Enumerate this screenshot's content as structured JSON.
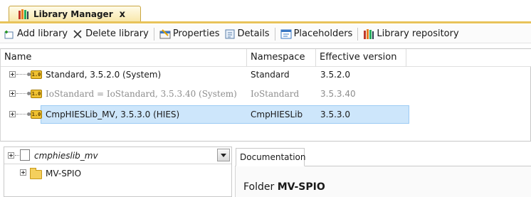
{
  "tab": {
    "title": "Library Manager",
    "close": "x"
  },
  "toolbar": {
    "add_library": "Add library",
    "delete_library": "Delete library",
    "properties": "Properties",
    "details": "Details",
    "placeholders": "Placeholders",
    "library_repository": "Library repository"
  },
  "grid": {
    "columns": [
      "Name",
      "Namespace",
      "Effective version"
    ],
    "rows": [
      {
        "badge": "1.0",
        "name": "Standard, 3.5.2.0 (System)",
        "namespace": "Standard",
        "version": "3.5.2.0",
        "grayed": false,
        "selected": false
      },
      {
        "badge": "1.0",
        "name": "IoStandard = IoStandard, 3.5.3.40 (System)",
        "namespace": "IoStandard",
        "version": "3.5.3.40",
        "grayed": true,
        "selected": false
      },
      {
        "badge": "1.0",
        "name": "CmpHIESLib_MV, 3.5.3.0 (HIES)",
        "namespace": "CmpHIESLib",
        "version": "3.5.3.0",
        "grayed": false,
        "selected": true
      }
    ]
  },
  "tree": {
    "root_label": "cmphieslib_mv",
    "child_label": "MV-SPIO"
  },
  "doc_panel": {
    "tab_label": "Documentation",
    "caption_prefix": "Folder",
    "caption_name": "MV-SPIO"
  }
}
